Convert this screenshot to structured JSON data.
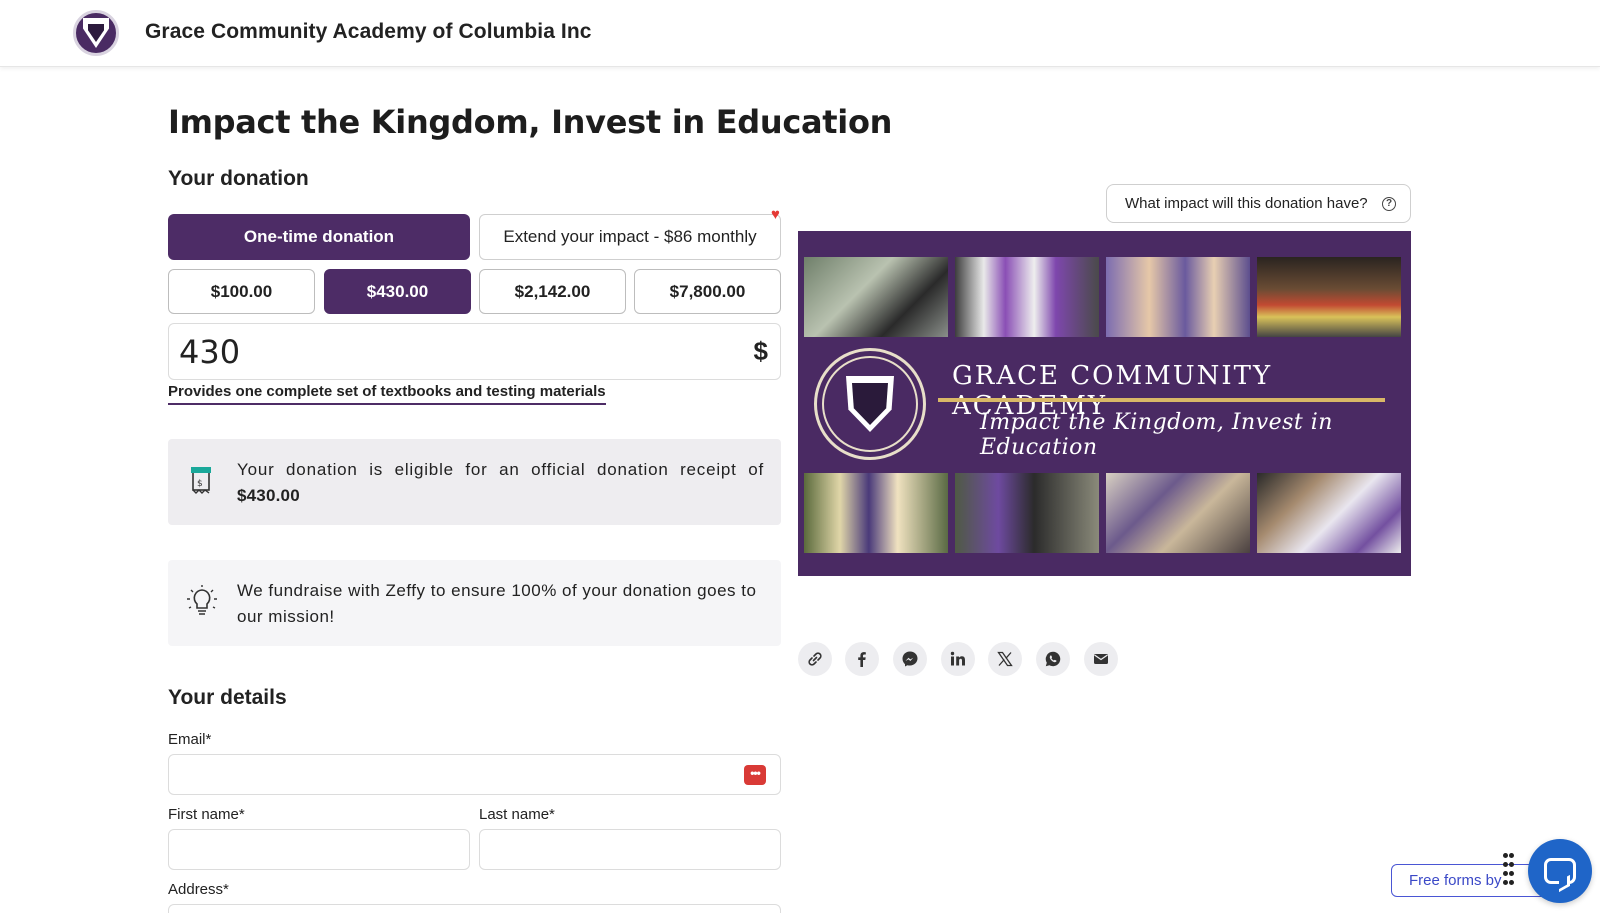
{
  "header": {
    "org_name": "Grace Community Academy of Columbia Inc"
  },
  "page": {
    "title": "Impact the Kingdom, Invest in Education"
  },
  "donation": {
    "section_title": "Your donation",
    "frequency": {
      "one_time_label": "One-time donation",
      "monthly_label": "Extend your impact - $86 monthly",
      "selected": "one-time"
    },
    "amount_options": [
      "$100.00",
      "$430.00",
      "$2,142.00",
      "$7,800.00"
    ],
    "selected_amount_index": 1,
    "amount_value": "430",
    "currency_symbol": "$",
    "impact_description": "Provides one complete set of textbooks and testing materials",
    "receipt_notice": "Your donation is eligible for an official donation receipt of",
    "receipt_amount": "$430.00",
    "zeffy_notice": "We fundraise with Zeffy to ensure 100% of your donation goes to our mission!"
  },
  "details": {
    "section_title": "Your details",
    "email_label": "Email*",
    "first_name_label": "First name*",
    "last_name_label": "Last name*",
    "address_label": "Address*"
  },
  "right": {
    "impact_question": "What impact will this donation have?",
    "banner_title": "GRACE COMMUNITY ACADEMY",
    "banner_tagline": "Impact the Kingdom, Invest in Education",
    "share_icons": [
      "link-icon",
      "facebook-icon",
      "messenger-icon",
      "linkedin-icon",
      "x-icon",
      "whatsapp-icon",
      "email-icon"
    ]
  },
  "footer": {
    "free_forms_label": "Free forms by"
  },
  "colors": {
    "brand_purple": "#4d2c66",
    "banner_purple": "#4a2a63",
    "gold": "#d9b867",
    "chat_blue": "#1f65c8"
  }
}
